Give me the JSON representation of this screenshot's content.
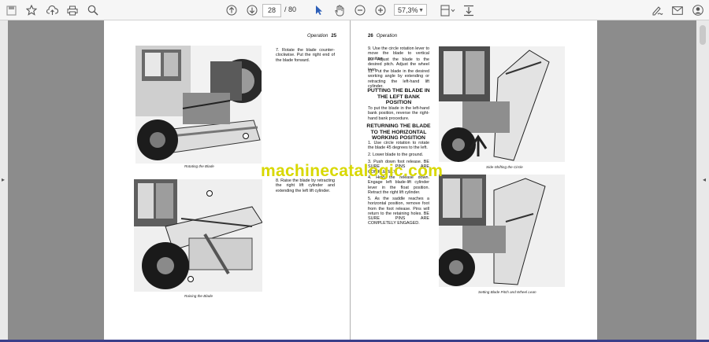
{
  "toolbar": {
    "page_current": "28",
    "page_total": "/ 80",
    "zoom": "57,3%"
  },
  "left_page": {
    "header_section": "Operation",
    "header_number": "25",
    "para1": "7. Rotate the blade counter-clockwise. Put the right end of the blade forward.",
    "caption1": "Rotating the Blade",
    "para2": "8. Raise the blade by retracting the right lift cylinder and extending the left lift cylinder.",
    "caption2": "Raising the Blade"
  },
  "right_page": {
    "header_number": "26",
    "header_section": "Operation",
    "para9": "9. Use the circle rotation lever to move the blade to vertical position.",
    "para10": "10. Adjust the blade to the desired pitch. Adjust the wheel lean.",
    "para11": "11. Put the blade in the desired working angle by extending or retracting the left-hand lift cylinder.",
    "heading1": "PUTTING THE BLADE IN THE LEFT BANK POSITION",
    "para_bank": "To put the blade in the left-hand bank position, reverse the right-hand bank procedure.",
    "heading2": "RETURNING THE BLADE TO THE HORIZONTAL WORKING POSITION",
    "ret1": "1. Use circle rotation to rotate the blade 45 degrees to the left.",
    "ret2": "2. Lower blade to the ground.",
    "ret3": "3. Push down foot release. BE SURE PINS ARE COMPLETELY",
    "ret4": "4. Hold the release down. Engage left blade-lift cylinder lever in the float position. Retract the right lift cylinder.",
    "ret5": "5. As the saddle reaches a horizontal position, remove foot from the foot release. Pins will return to the retaining holes. BE SURE PINS ARE COMPLETELY ENGAGED.",
    "caption1": "Side-Shifting the Circle",
    "caption2": "Setting Blade Pitch and Wheel Lean"
  },
  "watermark": "machinecatalogic.com",
  "colors": {
    "toolbar_bg": "#f6f6f6",
    "viewer_bg": "#8c8c8c",
    "page_bg": "#ffffff",
    "watermark": "#d8d800",
    "taskbar": "#3a3f8a"
  },
  "icons": [
    "save-icon",
    "bookmark-icon",
    "upload-icon",
    "print-icon",
    "zoom-search-icon",
    "page-up-icon",
    "page-down-icon",
    "select-cursor-icon",
    "hand-icon",
    "zoom-out-icon",
    "zoom-in-icon",
    "fit-page-icon",
    "scroll-mode-icon",
    "sign-icon",
    "mail-icon",
    "account-icon"
  ]
}
